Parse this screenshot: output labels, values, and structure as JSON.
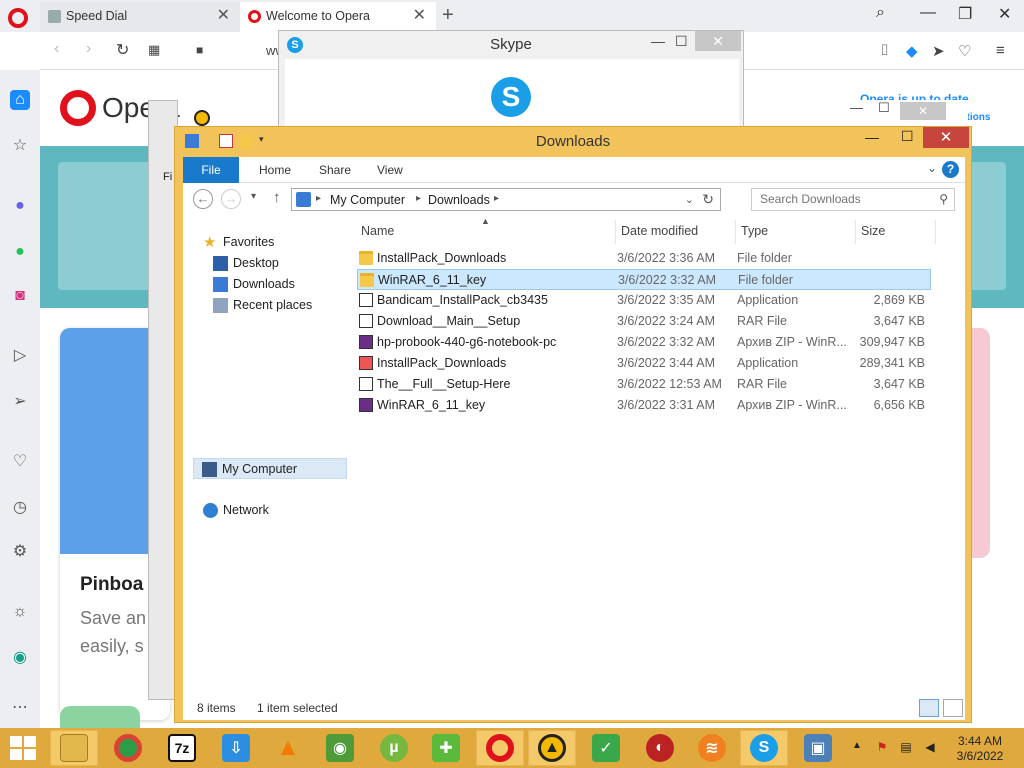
{
  "opera": {
    "tabs": [
      {
        "label": "Speed Dial"
      },
      {
        "label": "Welcome to Opera"
      }
    ],
    "url_partial": "www.op",
    "brand_text": "Opera",
    "promo_line1": "Opera is up to date",
    "promo_line2": "additions",
    "card_title": "Pinboa",
    "card_text1": "Save an",
    "card_text2": "easily, s",
    "fragment_text": "Fi"
  },
  "skype": {
    "title": "Skype"
  },
  "explorer": {
    "title": "Downloads",
    "ribbon_tabs": [
      "File",
      "Home",
      "Share",
      "View"
    ],
    "breadcrumb": [
      "My Computer",
      "Downloads"
    ],
    "search_placeholder": "Search Downloads",
    "nav": {
      "favorites": "Favorites",
      "desktop": "Desktop",
      "downloads": "Downloads",
      "recent": "Recent places",
      "my_computer": "My Computer",
      "network": "Network"
    },
    "columns": {
      "name": "Name",
      "date": "Date modified",
      "type": "Type",
      "size": "Size"
    },
    "files": [
      {
        "name": "InstallPack_Downloads",
        "date": "3/6/2022 3:36 AM",
        "type": "File folder",
        "size": "",
        "icon": "folder"
      },
      {
        "name": "WinRAR_6_11_key",
        "date": "3/6/2022 3:32 AM",
        "type": "File folder",
        "size": "",
        "icon": "folder",
        "selected": true
      },
      {
        "name": "Bandicam_InstallPack_cb3435",
        "date": "3/6/2022 3:35 AM",
        "type": "Application",
        "size": "2,869 KB",
        "icon": "app"
      },
      {
        "name": "Download__Main__Setup",
        "date": "3/6/2022 3:24 AM",
        "type": "RAR File",
        "size": "3,647 KB",
        "icon": "app"
      },
      {
        "name": "hp-probook-440-g6-notebook-pc",
        "date": "3/6/2022 3:32 AM",
        "type": "Архив ZIP - WinR...",
        "size": "309,947 KB",
        "icon": "zip"
      },
      {
        "name": "InstallPack_Downloads",
        "date": "3/6/2022 3:44 AM",
        "type": "Application",
        "size": "289,341 KB",
        "icon": "inst"
      },
      {
        "name": "The__Full__Setup-Here",
        "date": "3/6/2022 12:53 AM",
        "type": "RAR File",
        "size": "3,647 KB",
        "icon": "app"
      },
      {
        "name": "WinRAR_6_11_key",
        "date": "3/6/2022 3:31 AM",
        "type": "Архив ZIP - WinR...",
        "size": "6,656 KB",
        "icon": "zip"
      }
    ],
    "status": {
      "items": "8 items",
      "selected": "1 item selected"
    }
  },
  "taskbar": {
    "clock_time": "3:44 AM",
    "clock_date": "3/6/2022",
    "apps": [
      "file-explorer",
      "chrome",
      "7zip",
      "download-manager",
      "vlc",
      "green-installer",
      "utorrent",
      "installpack",
      "opera",
      "avast",
      "shield",
      "cyberlink",
      "sendanywhere",
      "skype",
      "remote-desktop"
    ]
  },
  "colors": {
    "explorer_frame": "#f2c35a",
    "explorer_close": "#c7453d",
    "ribbon_file": "#1979ca",
    "taskbar": "#dfa93e",
    "selection": "#cce8ff",
    "opera_red": "#e0111b"
  }
}
